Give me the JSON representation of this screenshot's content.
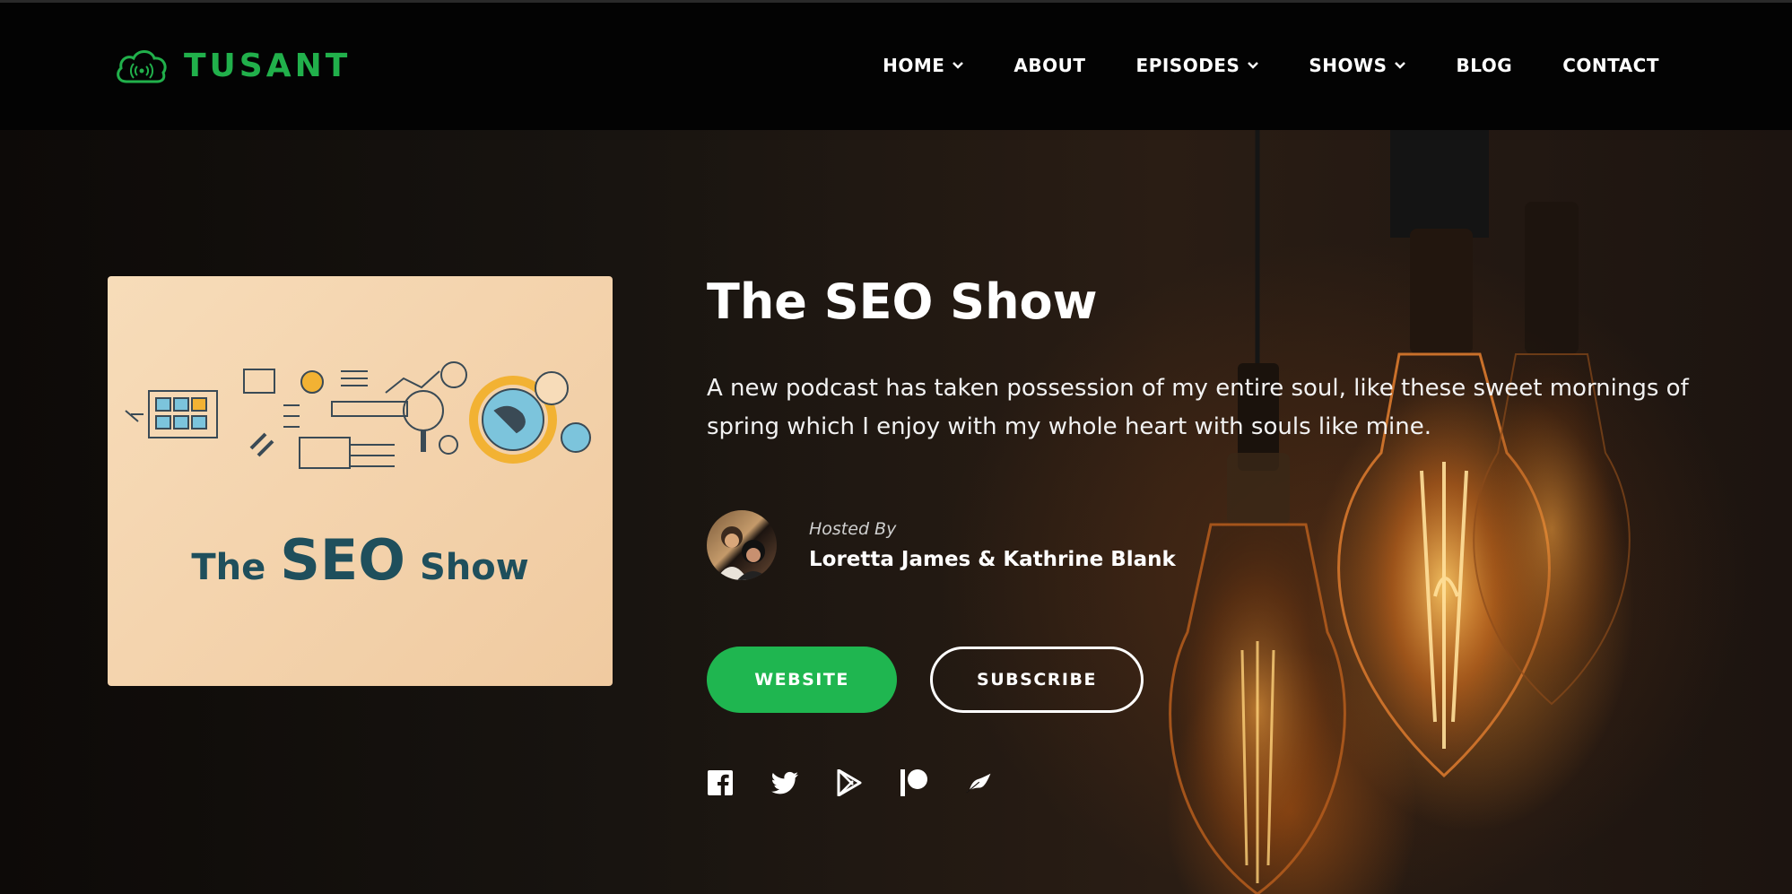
{
  "brand": {
    "name": "TUSANT",
    "icon": "cloud-podcast-icon",
    "color": "#21b04b"
  },
  "nav": {
    "items": [
      {
        "label": "HOME",
        "has_dropdown": true
      },
      {
        "label": "ABOUT",
        "has_dropdown": false
      },
      {
        "label": "EPISODES",
        "has_dropdown": true
      },
      {
        "label": "SHOWS",
        "has_dropdown": true
      },
      {
        "label": "BLOG",
        "has_dropdown": false
      },
      {
        "label": "CONTACT",
        "has_dropdown": false
      }
    ]
  },
  "show": {
    "title": "The SEO Show",
    "description": "A new podcast has taken possession of my entire soul, like these sweet mornings of spring which I enjoy with my whole heart with souls like mine.",
    "cover": {
      "title_prefix": "The",
      "title_main": "SEO",
      "title_suffix": "Show",
      "text_color": "#1f4f5c"
    }
  },
  "host": {
    "label": "Hosted By",
    "names": "Loretta James & Kathrine Blank"
  },
  "buttons": {
    "website": "WEBSITE",
    "subscribe": "SUBSCRIBE",
    "accent": "#1fb650"
  },
  "socials": [
    {
      "name": "facebook-icon"
    },
    {
      "name": "twitter-icon"
    },
    {
      "name": "google-play-icon"
    },
    {
      "name": "patreon-icon"
    },
    {
      "name": "feather-icon"
    }
  ]
}
